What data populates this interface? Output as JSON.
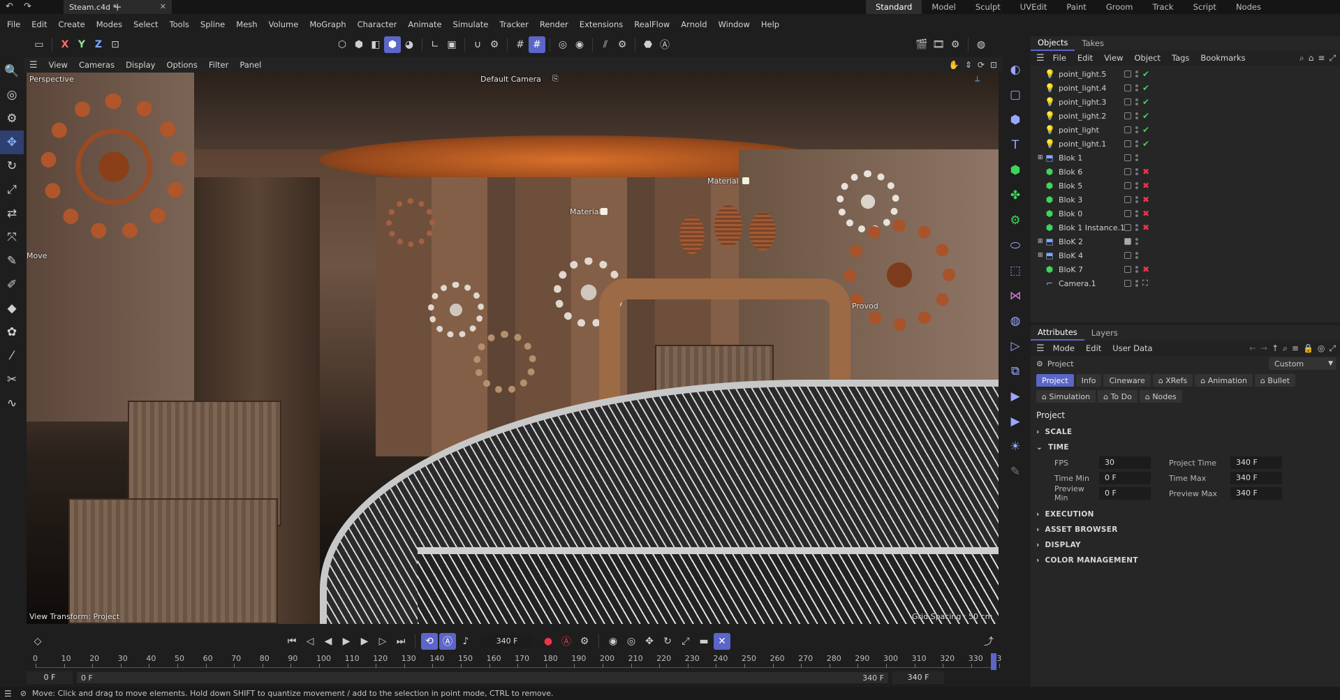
{
  "titlebar": {
    "document_tab": "Steam.c4d *",
    "workspaces": [
      "Standard",
      "Model",
      "Sculpt",
      "UVEdit",
      "Paint",
      "Groom",
      "Track",
      "Script",
      "Nodes"
    ],
    "active_workspace": "Standard"
  },
  "menubar": [
    "File",
    "Edit",
    "Create",
    "Modes",
    "Select",
    "Tools",
    "Spline",
    "Mesh",
    "Volume",
    "MoGraph",
    "Character",
    "Animate",
    "Simulate",
    "Tracker",
    "Render",
    "Extensions",
    "RealFlow",
    "Arnold",
    "Window",
    "Help"
  ],
  "axis_buttons": [
    "X",
    "Y",
    "Z"
  ],
  "viewport": {
    "menu": [
      "View",
      "Cameras",
      "Display",
      "Options",
      "Filter",
      "Panel"
    ],
    "view_name": "Perspective",
    "camera": "Default Camera",
    "labels": {
      "material1": "Material",
      "material2": "Material",
      "provod": "Provod",
      "move": "Move"
    },
    "view_transform": "View Transform: Project",
    "grid_spacing": "Grid Spacing : 50 cm"
  },
  "objects_panel": {
    "tabs": [
      "Objects",
      "Takes"
    ],
    "menu": [
      "File",
      "Edit",
      "View",
      "Object",
      "Tags",
      "Bookmarks"
    ],
    "rows": [
      {
        "name": "point_light.5",
        "icon": "light-icon",
        "status": "check"
      },
      {
        "name": "point_light.4",
        "icon": "light-icon",
        "status": "check"
      },
      {
        "name": "point_light.3",
        "icon": "light-icon",
        "status": "check"
      },
      {
        "name": "point_light.2",
        "icon": "light-icon",
        "status": "check"
      },
      {
        "name": "point_light",
        "icon": "light-icon",
        "status": "check"
      },
      {
        "name": "point_light.1",
        "icon": "light-icon",
        "status": "check"
      },
      {
        "name": "Blok 1",
        "icon": "group-icon",
        "status": "none"
      },
      {
        "name": "Blok  6",
        "icon": "mesh-icon",
        "status": "cross"
      },
      {
        "name": "Blok  5",
        "icon": "mesh-icon",
        "status": "cross"
      },
      {
        "name": "Blok 3",
        "icon": "mesh-icon",
        "status": "cross"
      },
      {
        "name": "Blok 0",
        "icon": "mesh-icon",
        "status": "cross"
      },
      {
        "name": "Blok 1 Instance.1",
        "icon": "mesh-icon",
        "status": "cross"
      },
      {
        "name": "BloK 2",
        "icon": "group-icon",
        "status": "box"
      },
      {
        "name": "BloK  4",
        "icon": "group-icon",
        "status": "none"
      },
      {
        "name": "BloK 7",
        "icon": "mesh-icon",
        "status": "cross"
      },
      {
        "name": "Camera.1",
        "icon": "camera-icon",
        "status": "target"
      }
    ]
  },
  "attributes_panel": {
    "tabs": [
      "Attributes",
      "Layers"
    ],
    "menu": [
      "Mode",
      "Edit",
      "User Data"
    ],
    "object_label": "Project",
    "preset": "Custom",
    "subtabs_row1": [
      "Project",
      "Info",
      "Cineware",
      "XRefs",
      "Animation",
      "Bullet"
    ],
    "subtabs_row2": [
      "Simulation",
      "To Do",
      "Nodes"
    ],
    "active_subtab": "Project",
    "heading": "Project",
    "sections_top": [
      "SCALE",
      "TIME"
    ],
    "time_fields": {
      "fps_label": "FPS",
      "fps": "30",
      "project_time_label": "Project Time",
      "project_time": "340 F",
      "time_min_label": "Time Min",
      "time_min": "0 F",
      "time_max_label": "Time Max",
      "time_max": "340 F",
      "preview_min_label": "Preview Min",
      "preview_min": "0 F",
      "preview_max_label": "Preview Max",
      "preview_max": "340 F"
    },
    "sections_bottom": [
      "EXECUTION",
      "ASSET BROWSER",
      "DISPLAY",
      "COLOR MANAGEMENT"
    ]
  },
  "timeline": {
    "current_frame": "340 F",
    "ticks": [
      "0",
      "10",
      "20",
      "30",
      "40",
      "50",
      "60",
      "70",
      "80",
      "90",
      "100",
      "110",
      "120",
      "130",
      "140",
      "150",
      "160",
      "170",
      "180",
      "190",
      "200",
      "210",
      "220",
      "230",
      "240",
      "250",
      "260",
      "270",
      "280",
      "290",
      "300",
      "310",
      "320",
      "330",
      "3"
    ],
    "range_start": "0 F",
    "range_start2": "0 F",
    "range_end": "340 F",
    "range_end2": "340 F"
  },
  "statusbar": {
    "message": "Move: Click and drag to move elements. Hold down SHIFT to quantize movement / add to the selection in point mode, CTRL to remove."
  },
  "colors": {
    "accent": "#5b66c8",
    "check": "#3fd45c",
    "cross": "#f0344a"
  }
}
